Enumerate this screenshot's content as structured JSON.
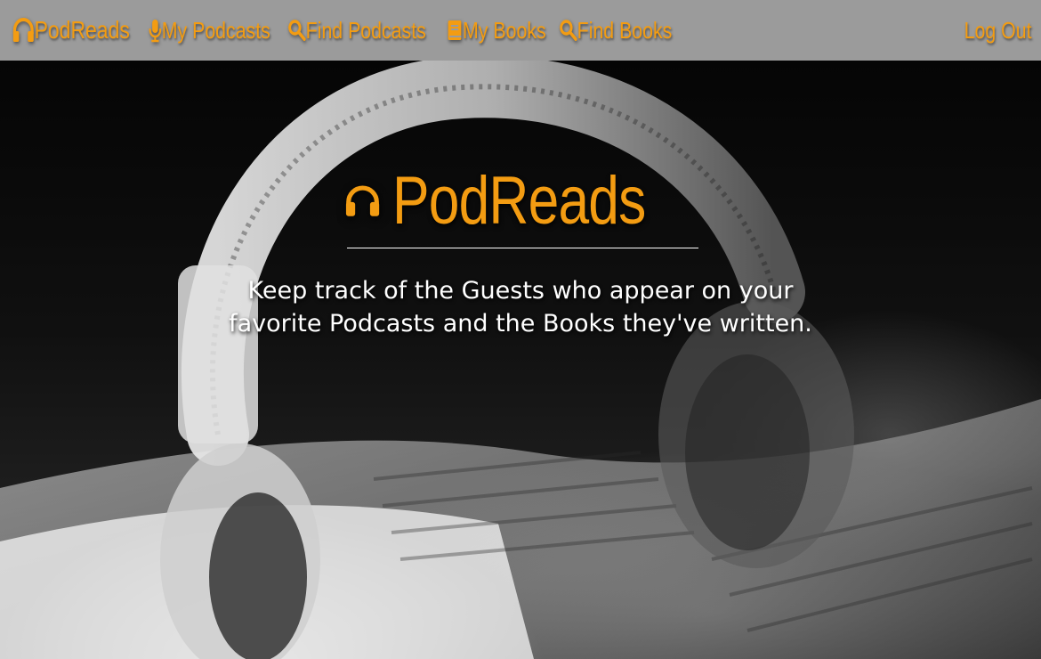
{
  "nav": {
    "brand": {
      "label": "PodReads",
      "icon": "headphones-icon"
    },
    "links": [
      {
        "label": "My Podcasts",
        "icon": "microphone-icon"
      },
      {
        "label": "Find Podcasts",
        "icon": "search-icon"
      },
      {
        "label": "My Books",
        "icon": "book-icon"
      },
      {
        "label": "Find Books",
        "icon": "search-icon"
      }
    ],
    "logout": "Log Out"
  },
  "hero": {
    "title": "PodReads",
    "title_icon": "headphones-icon",
    "tagline": "Keep track of the Guests who appear on your favorite Podcasts and the Books they've written.",
    "background": "headphones-on-open-book-photo"
  },
  "colors": {
    "accent": "#f39c12",
    "navbar_bg": "#9b9b9b",
    "text_light": "#ffffff"
  }
}
